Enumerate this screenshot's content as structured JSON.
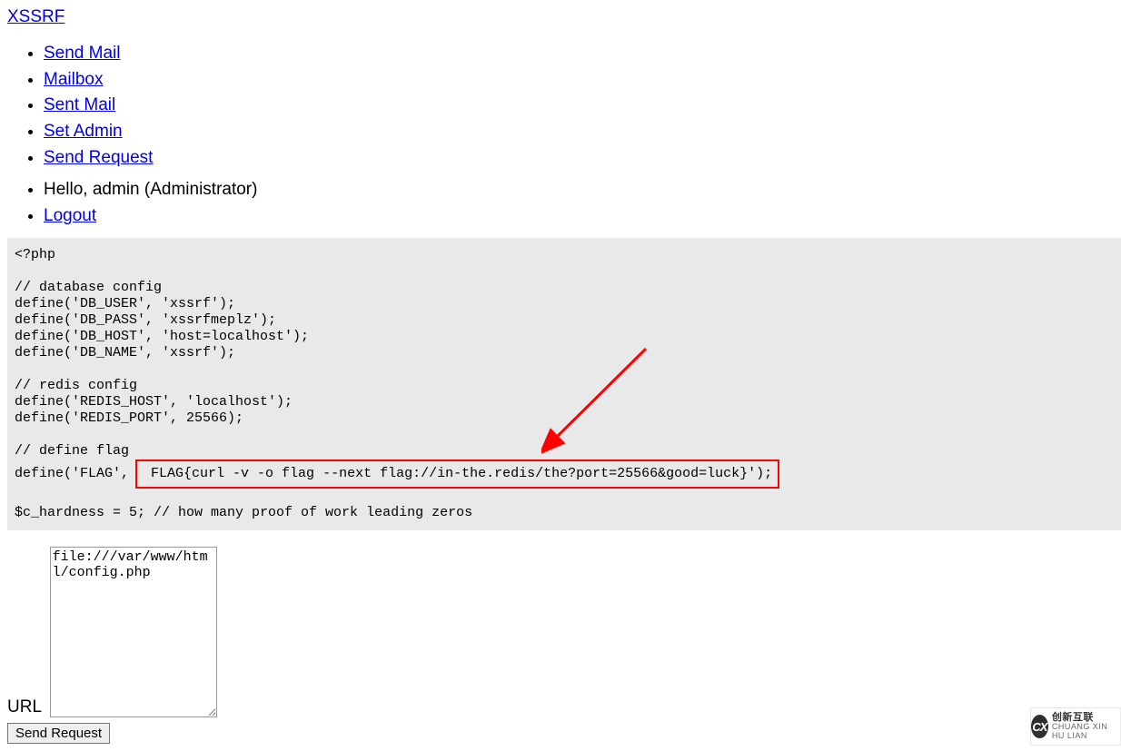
{
  "brand": {
    "label": "XSSRF"
  },
  "nav": {
    "items": [
      {
        "label": "Send Mail"
      },
      {
        "label": "Mailbox"
      },
      {
        "label": "Sent Mail"
      },
      {
        "label": "Set Admin"
      },
      {
        "label": "Send Request"
      }
    ]
  },
  "user": {
    "greeting": "Hello, admin (Administrator)",
    "logout": "Logout"
  },
  "code": {
    "l01": "<?php",
    "l02": "",
    "l03": "// database config",
    "l04": "define('DB_USER', 'xssrf');",
    "l05": "define('DB_PASS', 'xssrfmeplz');",
    "l06": "define('DB_HOST', 'host=localhost');",
    "l07": "define('DB_NAME', 'xssrf');",
    "l08": "",
    "l09": "// redis config",
    "l10": "define('REDIS_HOST', 'localhost');",
    "l11": "define('REDIS_PORT', 25566);",
    "l12": "",
    "l13": "// define flag",
    "l14_prefix": "define('FLAG', ",
    "l14_flag": " FLAG{curl -v -o flag --next flag://in-the.redis/the?port=25566&good=luck}');",
    "l15": "",
    "l16": "$c_hardness = 5; // how many proof of work leading zeros"
  },
  "form": {
    "url_label": "URL",
    "url_value": "file:///var/www/html/config.php",
    "submit_label": "Send Request"
  },
  "watermark": {
    "logo": "CX",
    "zh": "创新互联",
    "en": "CHUANG XIN HU LIAN"
  }
}
